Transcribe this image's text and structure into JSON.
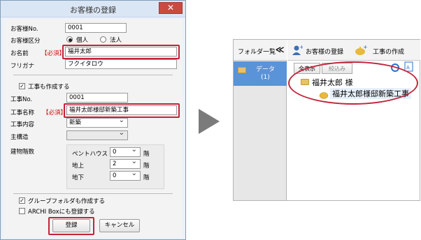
{
  "dialog": {
    "title": "お客様の登録",
    "close": "✕",
    "customer_no_label": "お客様No.",
    "customer_no": "0001",
    "customer_type_label": "お客様区分",
    "type_individual": "個人",
    "type_corporate": "法人",
    "name_label": "お名前",
    "required": "【必須】",
    "name_value": "福井太郎",
    "furigana_label": "フリガナ",
    "furigana_value": "フクイタロウ",
    "create_work_label": "工事も作成する",
    "work_no_label": "工事No.",
    "work_no": "0001",
    "work_name_label": "工事名称",
    "work_name_value": "福井太郎様邸新築工事",
    "work_content_label": "工事内容",
    "work_content_value": "新築",
    "structure_label": "主構造",
    "floors_label": "建物階数",
    "penthouse_label": "ペントハウス",
    "penthouse_value": "0",
    "above_label": "地上",
    "above_value": "2",
    "below_label": "地下",
    "below_value": "0",
    "floor_unit": "階",
    "group_folder_label": "グループフォルダも作成する",
    "archi_box_label": "ARCHI Boxにも登録する",
    "register_button": "登録",
    "cancel_button": "キャンセル"
  },
  "panel": {
    "folder_list_label": "フォルダ一覧",
    "collapse": "≪",
    "data_item": "データ",
    "data_count": "(1)",
    "tab_customer": "お客様の登録",
    "tab_work": "工事の作成",
    "show_all_button": "全表示",
    "search_button": "絞込み",
    "tree_customer": "福井太郎 様",
    "tree_work": "福井太郎様邸新築工事"
  },
  "colors": {
    "highlight": "#c4233a",
    "selected": "#5a93d8"
  }
}
